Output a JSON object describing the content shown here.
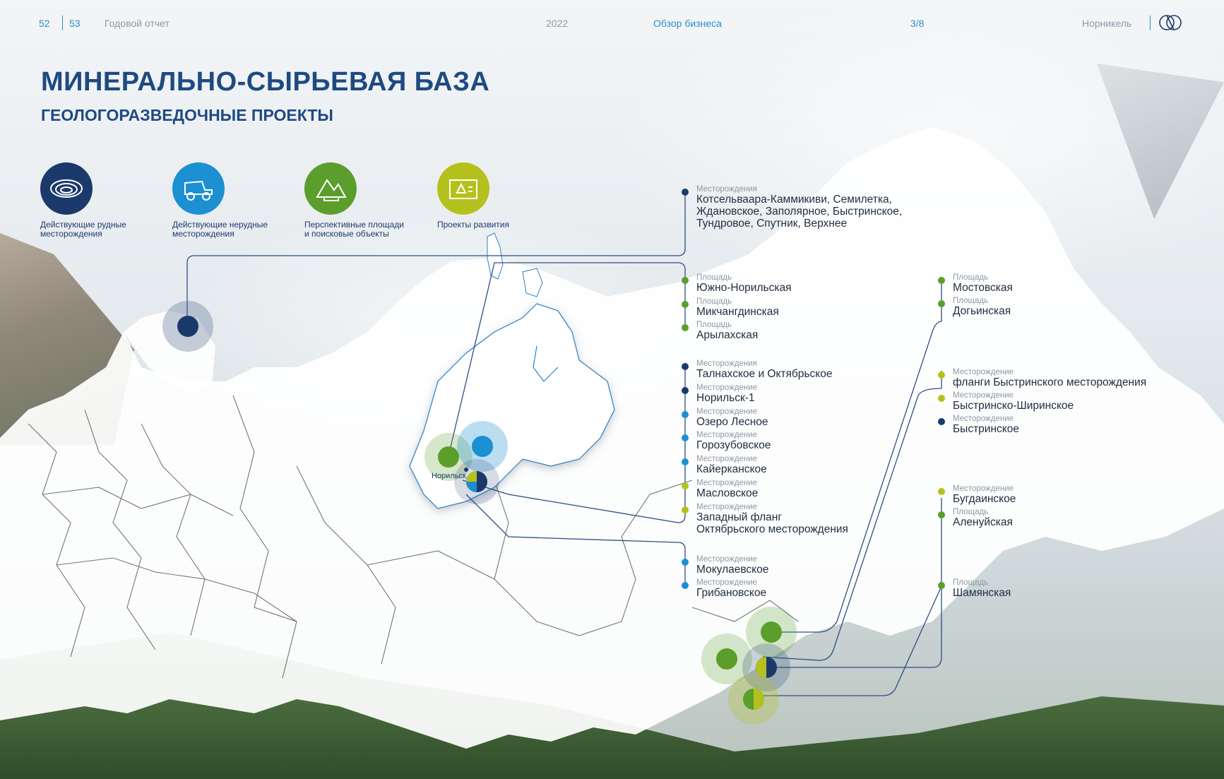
{
  "header": {
    "page_left": "52",
    "page_right": "53",
    "report": "Годовой отчет",
    "year": "2022",
    "section": "Обзор бизнеса",
    "pagination": "3/8",
    "company": "Норникель"
  },
  "title": "МИНЕРАЛЬНО-СЫРЬЕВАЯ БАЗА",
  "subtitle": "ГЕОЛОГОРАЗВЕДОЧНЫЕ ПРОЕКТЫ",
  "colors": {
    "ore": "#1b3a6b",
    "nonmetal": "#1d8fd3",
    "prospective": "#5b9e2b",
    "development": "#b4c11c",
    "line": "#2c4f86"
  },
  "legend": [
    {
      "label_line1": "Действующие рудные",
      "label_line2": "месторождения",
      "icon": "ore-pit-icon",
      "color_key": "ore"
    },
    {
      "label_line1": "Действующие нерудные",
      "label_line2": "месторождения",
      "icon": "mining-truck-icon",
      "color_key": "nonmetal"
    },
    {
      "label_line1": "Перспективные площади",
      "label_line2": "и поисковые объекты",
      "icon": "geologist-icon",
      "color_key": "prospective"
    },
    {
      "label_line1": "Проекты развития",
      "label_line2": "",
      "icon": "blueprint-icon",
      "color_key": "development"
    }
  ],
  "city_label": "Норильск",
  "groups": {
    "kola": [
      {
        "category": "Месторождения",
        "lines": [
          "Котсельваара-Каммикиви, Семилетка,",
          "Ждановское, Заполярное, Быстринское,",
          "Тундровое, Спутник, Верхнее"
        ],
        "color_key": "ore"
      }
    ],
    "norilsk_areas": [
      {
        "category": "Площадь",
        "lines": [
          "Южно-Норильская"
        ],
        "color_key": "prospective"
      },
      {
        "category": "Площадь",
        "lines": [
          "Микчангдинская"
        ],
        "color_key": "prospective"
      },
      {
        "category": "Площадь",
        "lines": [
          "Арылахская"
        ],
        "color_key": "prospective"
      }
    ],
    "norilsk_deposits": [
      {
        "category": "Месторождения",
        "lines": [
          "Талнахское и Октябрьское"
        ],
        "color_key": "ore"
      },
      {
        "category": "Месторождение",
        "lines": [
          "Норильск-1"
        ],
        "color_key": "ore"
      },
      {
        "category": "Месторождение",
        "lines": [
          "Озеро Лесное"
        ],
        "color_key": "nonmetal"
      },
      {
        "category": "Месторождение",
        "lines": [
          "Горозубовское"
        ],
        "color_key": "nonmetal"
      },
      {
        "category": "Месторождение",
        "lines": [
          "Кайерканское"
        ],
        "color_key": "nonmetal"
      },
      {
        "category": "Месторождение",
        "lines": [
          "Масловское"
        ],
        "color_key": "development"
      },
      {
        "category": "Месторождение",
        "lines": [
          "Западный фланг",
          "Октябрьского месторождения"
        ],
        "color_key": "development"
      }
    ],
    "norilsk_nonmetal": [
      {
        "category": "Месторождение",
        "lines": [
          "Мокулаевское"
        ],
        "color_key": "nonmetal"
      },
      {
        "category": "Месторождение",
        "lines": [
          "Грибановское"
        ],
        "color_key": "nonmetal"
      }
    ],
    "east_areas": [
      {
        "category": "Площадь",
        "lines": [
          "Мостовская"
        ],
        "color_key": "prospective"
      },
      {
        "category": "Площадь",
        "lines": [
          "Догьинская"
        ],
        "color_key": "prospective"
      }
    ],
    "bystrinsky": [
      {
        "category": "Месторождение",
        "lines": [
          "фланги Быстринского месторождения"
        ],
        "color_key": "development"
      },
      {
        "category": "Месторождение",
        "lines": [
          "Быстринско-Ширинское"
        ],
        "color_key": "development"
      },
      {
        "category": "Месторождение",
        "lines": [
          "Быстринское"
        ],
        "color_key": "ore"
      }
    ],
    "east_south": [
      {
        "category": "Месторождение",
        "lines": [
          "Бугдаинское"
        ],
        "color_key": "development"
      },
      {
        "category": "Площадь",
        "lines": [
          "Аленуйская"
        ],
        "color_key": "prospective"
      }
    ],
    "shamyanskaya": [
      {
        "category": "Площадь",
        "lines": [
          "Шамянская"
        ],
        "color_key": "prospective"
      }
    ]
  }
}
